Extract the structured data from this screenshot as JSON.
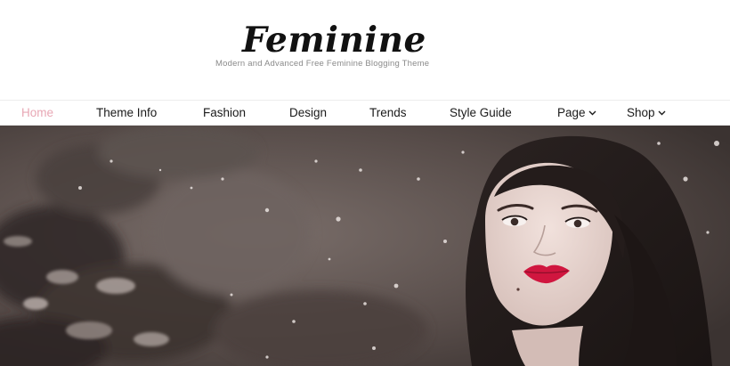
{
  "site": {
    "title": "Feminine",
    "tagline": "Modern and Advanced Free Feminine Blogging Theme"
  },
  "nav": {
    "items": [
      {
        "label": "Home",
        "active": true
      },
      {
        "label": "Theme Info"
      },
      {
        "label": "Fashion"
      },
      {
        "label": "Design"
      },
      {
        "label": "Trends"
      },
      {
        "label": "Style Guide"
      },
      {
        "label": "Page",
        "icon": "chevron-down-icon"
      },
      {
        "label": "Shop",
        "icon": "chevron-down-icon"
      }
    ]
  },
  "colors": {
    "active_nav": "#e8a7b4",
    "text": "#1a1a1a",
    "tagline": "#8a8a8a",
    "hero_tone": "#5c524f",
    "lips": "#d0163f"
  }
}
